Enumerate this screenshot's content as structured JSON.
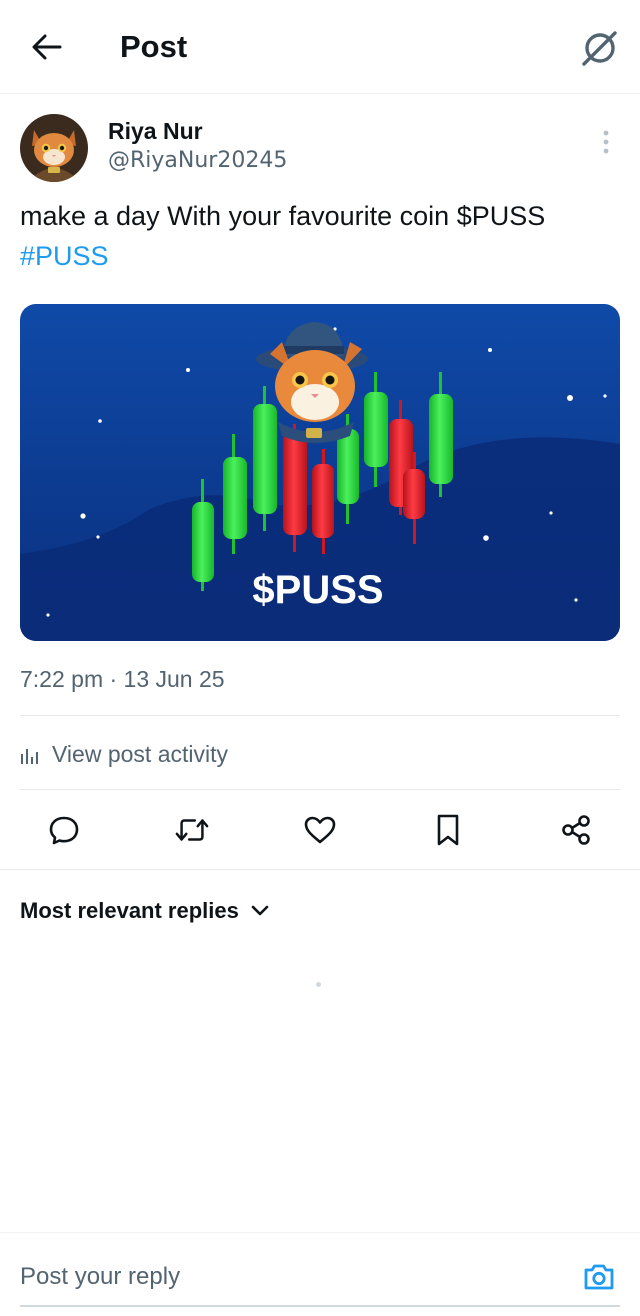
{
  "header": {
    "title": "Post",
    "back_icon": "arrow-left-icon",
    "grok_icon": "grok-icon"
  },
  "post": {
    "author_name": "Riya Nur",
    "author_handle": "@RiyaNur20245",
    "text_plain": "make a day With your favourite coin $PUSS ",
    "hashtag": "#PUSS",
    "media_caption": "$PUSS",
    "timestamp": "7:22 pm · 13 Jun 25",
    "view_activity_label": "View post activity"
  },
  "actions": {
    "reply_icon": "comment-icon",
    "repost_icon": "repost-icon",
    "like_icon": "heart-icon",
    "bookmark_icon": "bookmark-icon",
    "share_icon": "share-icon"
  },
  "replies": {
    "sort_label": "Most relevant replies"
  },
  "composer": {
    "placeholder": "Post your reply",
    "camera_icon": "camera-icon"
  },
  "colors": {
    "accent": "#1d9bf0",
    "text": "#0f1419",
    "secondary": "#536471",
    "media_bg": "#0d3d8f",
    "candle_green": "#22d63a",
    "candle_red": "#e8202b"
  }
}
